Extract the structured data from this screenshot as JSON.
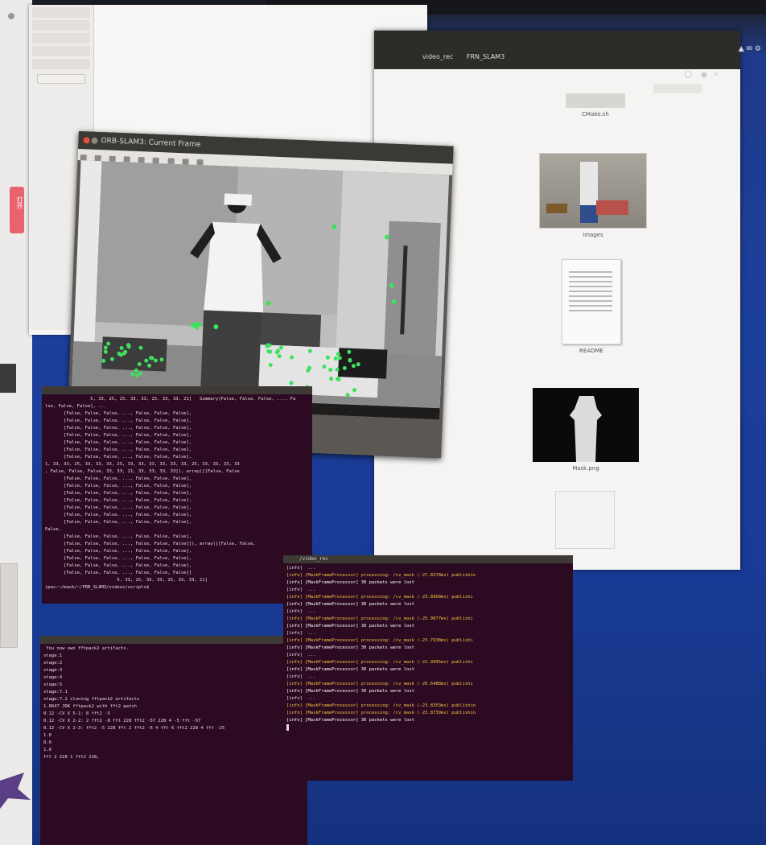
{
  "left_sidebar": {
    "badge_text": "打开"
  },
  "top_window": {
    "side_items": [
      "",
      "",
      "",
      "",
      ""
    ],
    "button": ""
  },
  "files": {
    "path": [
      "video_rec",
      "FRN_SLAM3"
    ],
    "tray": "▲ ✉ ⚙",
    "items": [
      {
        "label": "CMake.sh",
        "sub": ""
      },
      {
        "label": "images",
        "sub": ""
      },
      {
        "label": "README",
        "sub": ""
      },
      {
        "label": "Mask.png",
        "sub": ""
      }
    ]
  },
  "frame": {
    "title": "ORB-SLAM3: Current Frame",
    "status": "SLAM MODE | KFs: 0, MPs: 1143, Matches: 286"
  },
  "term1": {
    "title": "",
    "lines": [
      "                 5, 33, 25, 25, 33, 33, 25, 33, 33, 21]   Summary(False, False, False, ..., Fa",
      "lse, False, False], ...",
      "       [False, False, False, ..., False, False, False],",
      "       [False, False, False, ..., False, False, False],",
      "       [False, False, False, ..., False, False, False],",
      "       [False, False, False, ..., False, False, False],",
      "       [False, False, False, ..., False, False, False],",
      "       [False, False, False, ..., False, False, False],",
      "       [False, False, False, ..., False, False, False],",
      "1, 33, 33, 25, 33, 33, 33, 25, 33, 33, 33, 33, 33, 33, 25, 33, 33, 33, 33",
      ", False, False, False, 33, 33, 21, 33, 33, 33, 33]), array([[False, False",
      "       [False, False, False, ..., False, False, False],",
      "       [False, False, False, ..., False, False, False],",
      "       [False, False, False, ..., False, False, False],",
      "       [False, False, False, ..., False, False, False],",
      "       [False, False, False, ..., False, False, False],",
      "       [False, False, False, ..., False, False, False],",
      "       [False, False, False, ..., False, False, False],",
      "False,",
      "       [False, False, False, ..., False, False, False],",
      "       [False, False, False, ..., False, False, False]]), array([[False, False,",
      "       [False, False, False, ..., False, False, False],",
      "       [False, False, False, ..., False, False, False],",
      "       [False, False, False, ..., False, False, False],",
      "       [False, False, False, ..., False, False, False]]",
      "                           5, 33, 25, 33, 33, 25, 33, 33, 21]",
      "ipas:~/mask/~/FRN_SLAM3/videos/scripts$ "
    ]
  },
  "term2": {
    "title": "/video_rec",
    "lines": [
      "[info]  ...",
      "[info] [MaskFrameProcessor] processing: /cv_mask (-27.8378ms) publishin",
      "[info] [MaskFrameProcessor] 30 packets were lost",
      "[info]  ...",
      "[info] [MaskFrameProcessor] processing: /cv_mask (-23.8968ms) publishi",
      "[info] [MaskFrameProcessor] 30 packets were lost",
      "[info]  ...",
      "[info] [MaskFrameProcessor] processing: /cv_mask (-25.9877ms) publishi",
      "[info] [MaskFrameProcessor] 30 packets were lost",
      "[info]  ...",
      "[info] [MaskFrameProcessor] processing: /cv_mask (-23.7638ms) publishi",
      "[info] [MaskFrameProcessor] 30 packets were lost",
      "[info]  ...",
      "[info] [MaskFrameProcessor] processing: /cv_mask (-22.9995ms) publishi",
      "[info] [MaskFrameProcessor] 30 packets were lost",
      "[info]  ...",
      "[info] [MaskFrameProcessor] processing: /cv_mask (-26.6488ms) publishi",
      "[info] [MaskFrameProcessor] 30 packets were lost",
      "[info]  ...",
      "[info] [MaskFrameProcessor] processing: /cv_mask (-23.8353ms) publishin",
      "[info] [MaskFrameProcessor] processing: /cv_mask (-23.8739ms) publishin",
      "[info] [MaskFrameProcessor] 30 packets were lost"
    ]
  },
  "term3": {
    "title": "",
    "lines": [
      " You now own fftpack2 artifacts.",
      "stage:1",
      "",
      "stage:2",
      "",
      "stage:3",
      "",
      "stage:4",
      "",
      "stage:5",
      "",
      "stage:7.1",
      "",
      "",
      "stage:7.2 cloning fftpack2 artifacts",
      "1.0647 JDK fftpack2 with fft2 patch",
      "",
      "0.12 -CV X 5-1: 0 fft2 -5",
      "0.12 -CV X 2-2: 2 fft2 -8 fft 228 fft2 -57 228 4 -5 fft -57",
      "0.12 -CV X 2-3: fft2 -5 228 fft 2 fft2 -6 4 fft 6 fft2 228 4 fft -25",
      "1.0",
      "0.0",
      "1.0",
      "",
      "fft 2 228 1 fft2 228,",
      ""
    ]
  }
}
